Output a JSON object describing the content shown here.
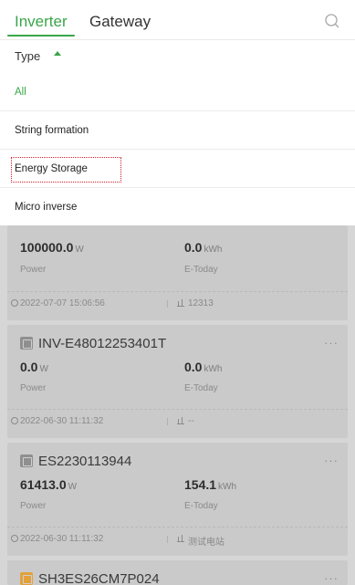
{
  "tabs": [
    {
      "label": "Inverter",
      "active": true
    },
    {
      "label": "Gateway",
      "active": false
    }
  ],
  "filter": {
    "type_label": "Type",
    "options": [
      "All",
      "String formation",
      "Energy Storage",
      "Micro inverse"
    ],
    "selected": "All"
  },
  "devices": [
    {
      "name": "",
      "power_value": "100000.0",
      "power_unit": "W",
      "power_label": "Power",
      "etoday_value": "0.0",
      "etoday_unit": "kWh",
      "etoday_label": "E-Today",
      "timestamp": "2022-07-07 15:06:56",
      "plant": "12313"
    },
    {
      "name": "INV-E48012253401T",
      "power_value": "0.0",
      "power_unit": "W",
      "power_label": "Power",
      "etoday_value": "0.0",
      "etoday_unit": "kWh",
      "etoday_label": "E-Today",
      "timestamp": "2022-06-30 11:11:32",
      "plant": "--"
    },
    {
      "name": "ES2230113944",
      "power_value": "61413.0",
      "power_unit": "W",
      "power_label": "Power",
      "etoday_value": "154.1",
      "etoday_unit": "kWh",
      "etoday_label": "E-Today",
      "timestamp": "2022-06-30 11:11:32",
      "plant": "测试电站"
    },
    {
      "name": "SH3ES26CM7P024"
    }
  ],
  "colors": {
    "accent": "#3aa64a",
    "highlight": "#d0202c",
    "overlay": "#d6d6d6",
    "card": "#cacaca"
  },
  "icons": {
    "search": "search-icon",
    "device": "device-icon",
    "more": "more-icon",
    "clock": "clock-icon",
    "plant": "plant-icon"
  }
}
